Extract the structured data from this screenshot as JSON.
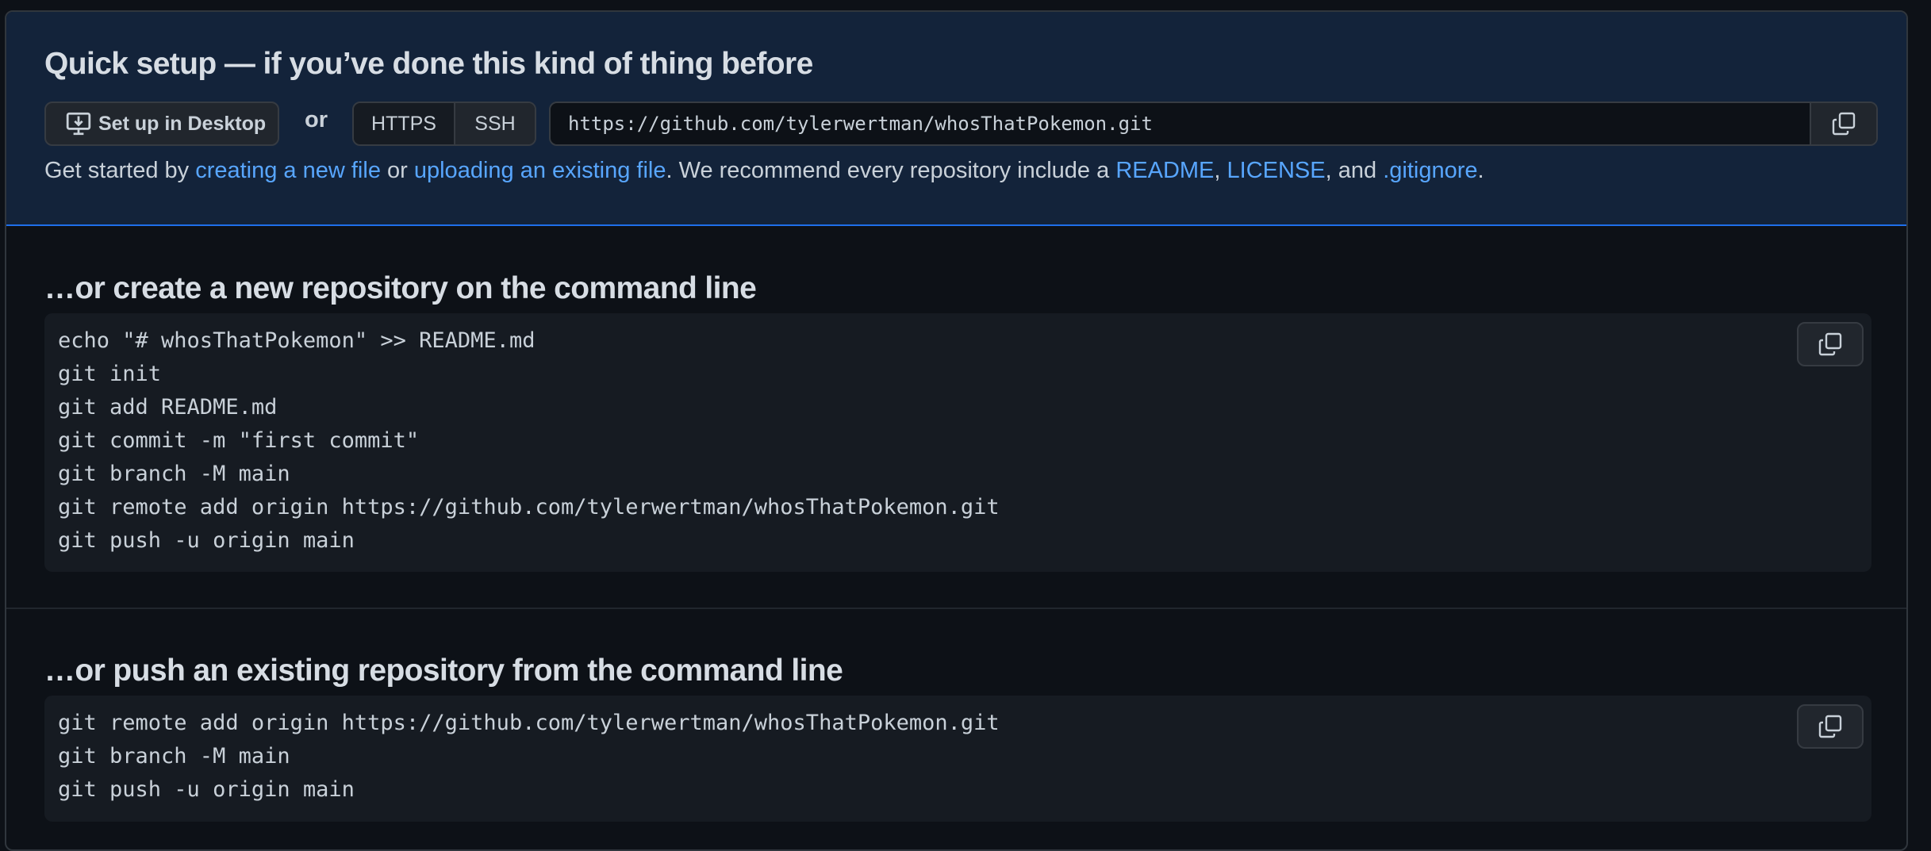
{
  "quick_setup": {
    "title": "Quick setup — if you’ve done this kind of thing before",
    "desktop_button": "Set up in Desktop",
    "or": "or",
    "protocols": [
      "HTTPS",
      "SSH"
    ],
    "selected_protocol": "HTTPS",
    "clone_url": "https://github.com/tylerwertman/whosThatPokemon.git",
    "get_started": {
      "prefix": "Get started by ",
      "link1": "creating a new file",
      "mid1": " or ",
      "link2": "uploading an existing file",
      "mid2": ". We recommend every repository include a ",
      "link3": "README",
      "sep1": ", ",
      "link4": "LICENSE",
      "sep2": ", and ",
      "link5": ".gitignore",
      "suffix": "."
    }
  },
  "create_section": {
    "title": "…or create a new repository on the command line",
    "code": "echo \"# whosThatPokemon\" >> README.md\ngit init\ngit add README.md\ngit commit -m \"first commit\"\ngit branch -M main\ngit remote add origin https://github.com/tylerwertman/whosThatPokemon.git\ngit push -u origin main"
  },
  "push_section": {
    "title": "…or push an existing repository from the command line",
    "code": "git remote add origin https://github.com/tylerwertman/whosThatPokemon.git\ngit branch -M main\ngit push -u origin main"
  },
  "colors": {
    "background": "#0d1117",
    "quick_setup_bg": "#13233a",
    "link": "#58a6ff",
    "code_bg": "#161b22"
  },
  "icons": {
    "desktop": "desktop-download-icon",
    "copy": "copy-icon"
  }
}
